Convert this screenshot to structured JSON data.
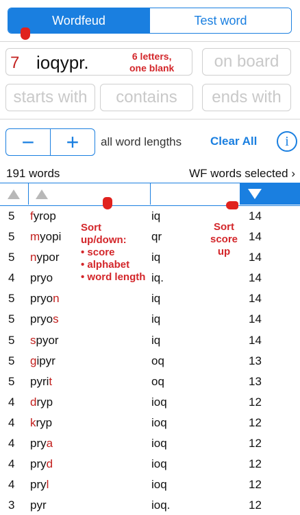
{
  "tabs": {
    "active": "Wordfeud",
    "other": "Test word"
  },
  "rack": {
    "number": "7",
    "letters": "ioqypr.",
    "note_line1": "6 letters,",
    "note_line2": "one blank"
  },
  "placeholders": {
    "on_board": "on board",
    "starts_with": "starts with",
    "contains": "contains",
    "ends_with": "ends with"
  },
  "stepper": {
    "minus": "−",
    "plus": "+"
  },
  "length_filter": "all word lengths",
  "clear_all": "Clear All",
  "info": "i",
  "count": "191 words",
  "dictionary": "WF words selected ›",
  "annotations": {
    "sort_title": "Sort\nup/down:",
    "sort_items": [
      "• score",
      "• alphabet",
      "• word length"
    ],
    "score_sort": "Sort\nscore\nup"
  },
  "rows": [
    {
      "len": "5",
      "hl_pre": "",
      "hl": "f",
      "rest": "yrop",
      "blank": "iq",
      "score": "14"
    },
    {
      "len": "5",
      "hl_pre": "",
      "hl": "m",
      "rest": "yopi",
      "blank": "qr",
      "score": "14"
    },
    {
      "len": "5",
      "hl_pre": "",
      "hl": "n",
      "rest": "ypor",
      "blank": "iq",
      "score": "14"
    },
    {
      "len": "4",
      "hl_pre": "pryo",
      "hl": "",
      "rest": "",
      "blank": "iq.",
      "score": "14"
    },
    {
      "len": "5",
      "hl_pre": "pryo",
      "hl": "n",
      "rest": "",
      "blank": "iq",
      "score": "14"
    },
    {
      "len": "5",
      "hl_pre": "pryo",
      "hl": "s",
      "rest": "",
      "blank": "iq",
      "score": "14"
    },
    {
      "len": "5",
      "hl_pre": "",
      "hl": "s",
      "rest": "pyor",
      "blank": "iq",
      "score": "14"
    },
    {
      "len": "5",
      "hl_pre": "",
      "hl": "g",
      "rest": "ipyr",
      "blank": "oq",
      "score": "13"
    },
    {
      "len": "5",
      "hl_pre": "pyri",
      "hl": "t",
      "rest": "",
      "blank": "oq",
      "score": "13"
    },
    {
      "len": "4",
      "hl_pre": "",
      "hl": "d",
      "rest": "ryp",
      "blank": "ioq",
      "score": "12"
    },
    {
      "len": "4",
      "hl_pre": "",
      "hl": "k",
      "rest": "ryp",
      "blank": "ioq",
      "score": "12"
    },
    {
      "len": "4",
      "hl_pre": "pry",
      "hl": "a",
      "rest": "",
      "blank": "ioq",
      "score": "12"
    },
    {
      "len": "4",
      "hl_pre": "pry",
      "hl": "d",
      "rest": "",
      "blank": "ioq",
      "score": "12"
    },
    {
      "len": "4",
      "hl_pre": "pry",
      "hl": "l",
      "rest": "",
      "blank": "ioq",
      "score": "12"
    },
    {
      "len": "3",
      "hl_pre": "pyr",
      "hl": "",
      "rest": "",
      "blank": "ioq.",
      "score": "12"
    }
  ],
  "colors": {
    "accent": "#1a7fe0",
    "highlight": "#c2201e",
    "annotation": "#d3262a"
  }
}
